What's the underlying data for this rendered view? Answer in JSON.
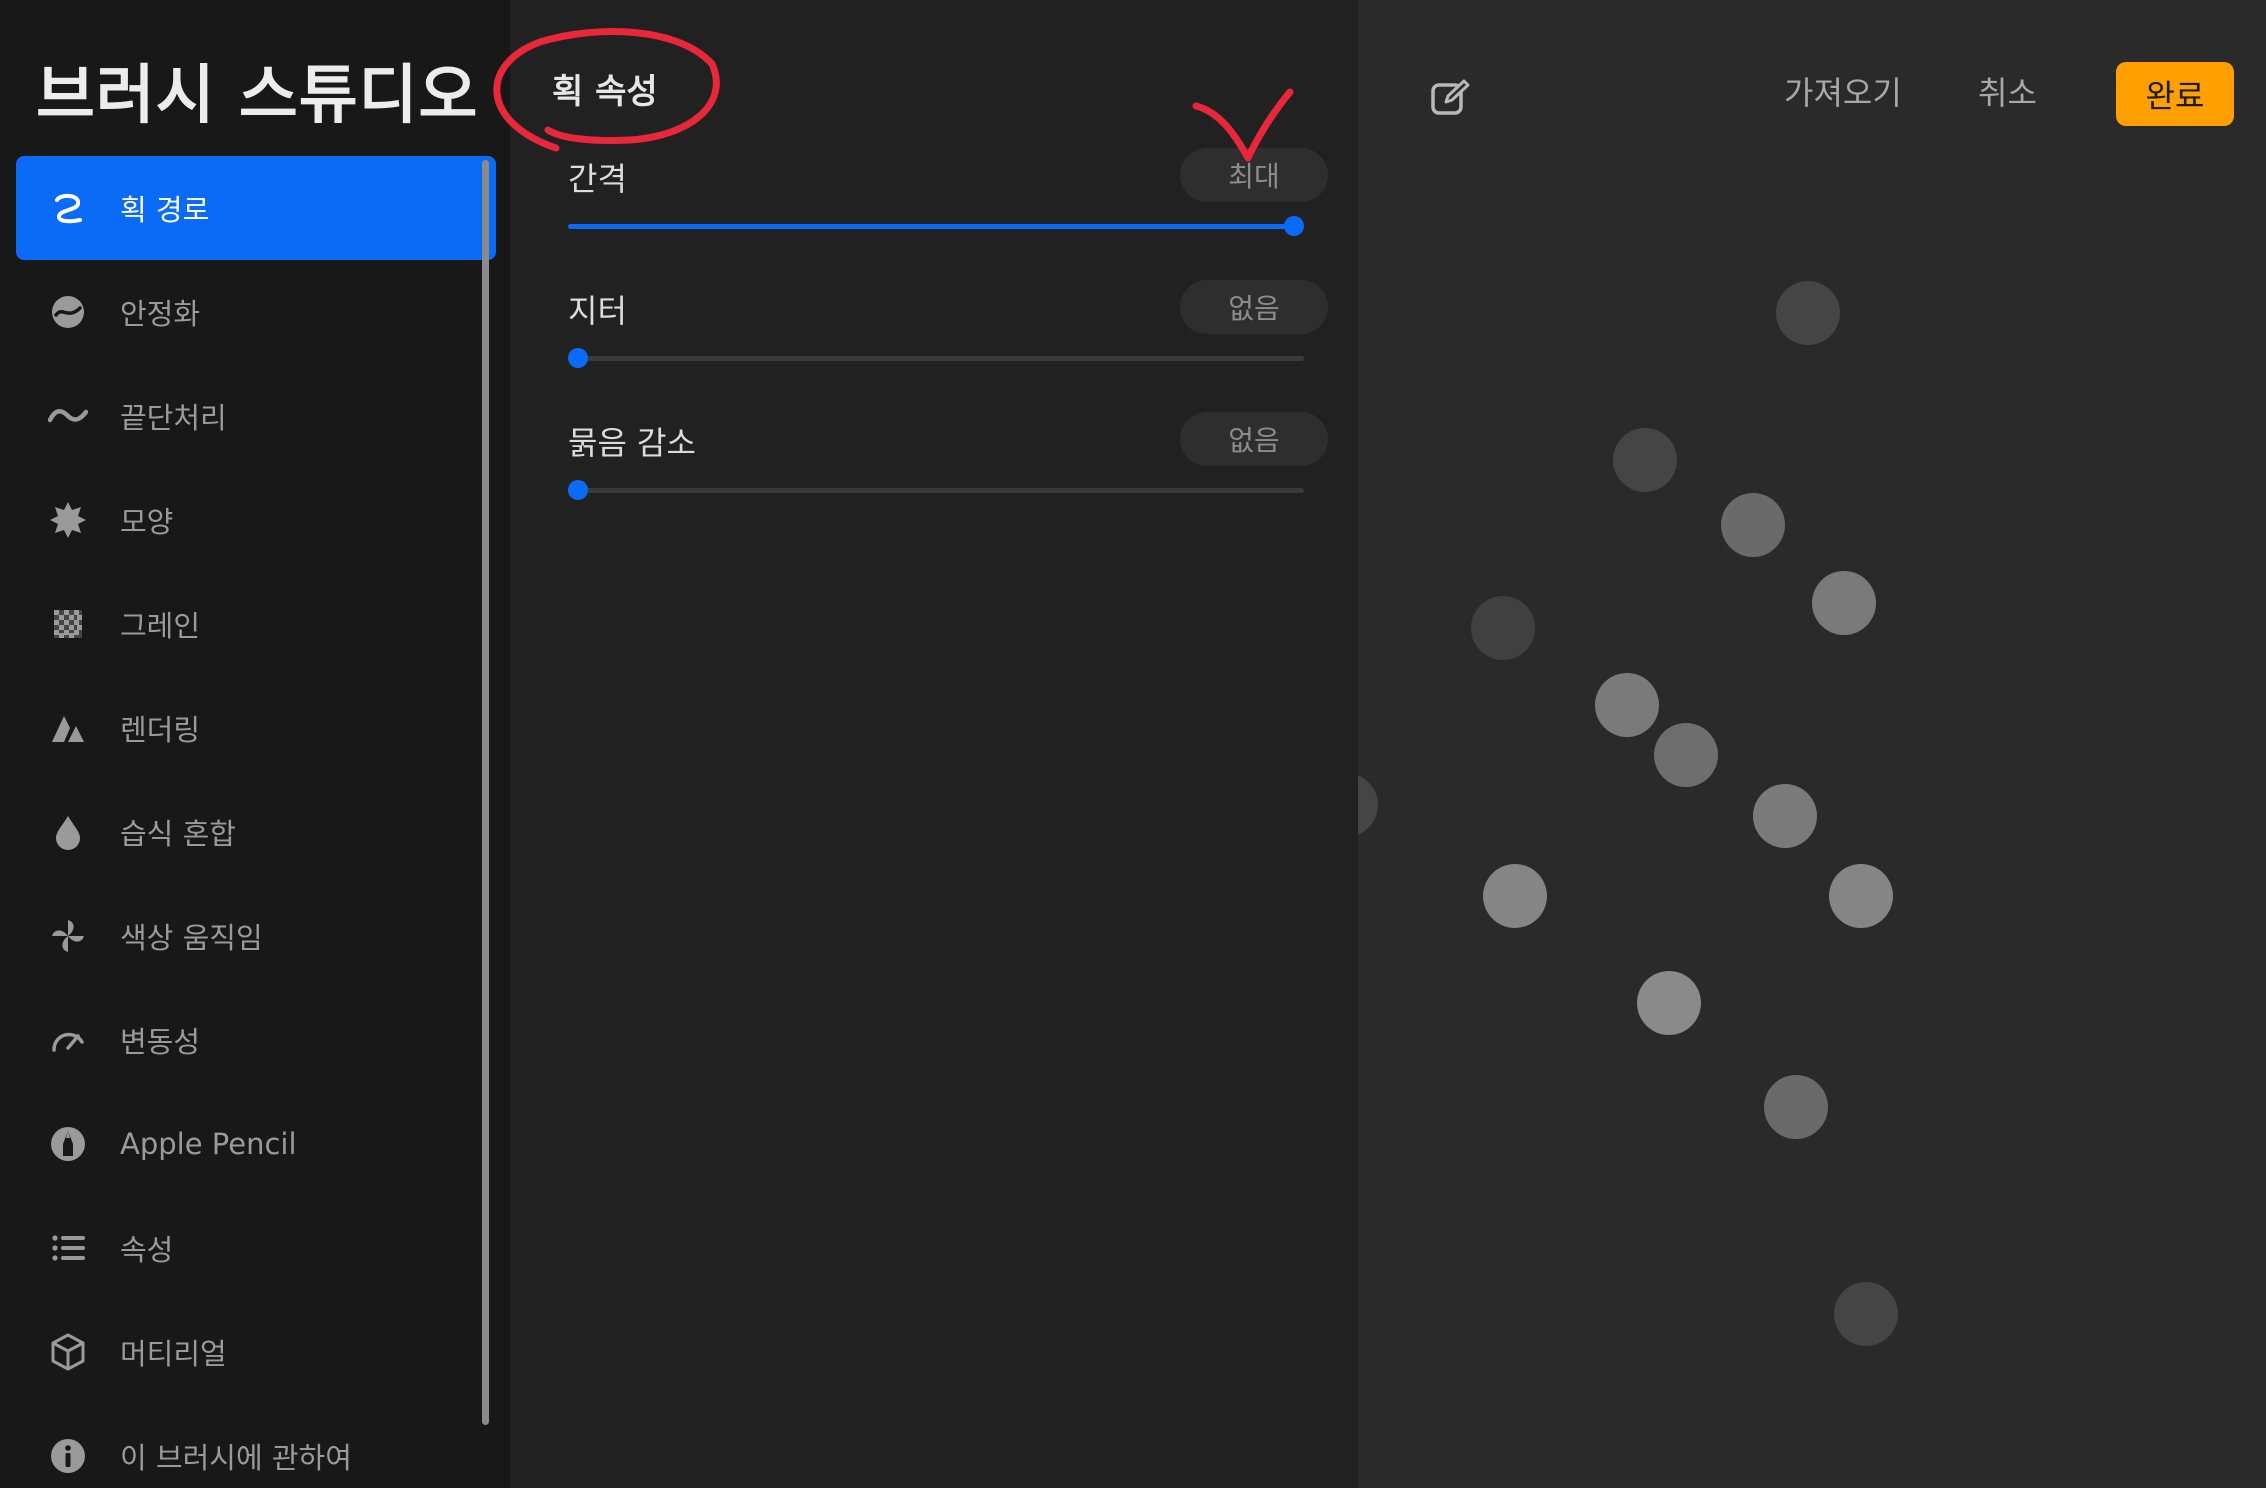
{
  "sidebar": {
    "title": "브러시 스튜디오",
    "items": [
      {
        "label": "획 경로",
        "icon": "stroke-path-icon",
        "selected": true
      },
      {
        "label": "안정화",
        "icon": "stabilization-icon"
      },
      {
        "label": "끝단처리",
        "icon": "taper-icon"
      },
      {
        "label": "모양",
        "icon": "shape-icon"
      },
      {
        "label": "그레인",
        "icon": "grain-icon"
      },
      {
        "label": "렌더링",
        "icon": "rendering-icon"
      },
      {
        "label": "습식 혼합",
        "icon": "wet-mix-icon"
      },
      {
        "label": "색상 움직임",
        "icon": "color-dynamics-icon"
      },
      {
        "label": "변동성",
        "icon": "dynamics-icon"
      },
      {
        "label": "Apple Pencil",
        "icon": "apple-pencil-icon"
      },
      {
        "label": "속성",
        "icon": "properties-icon"
      },
      {
        "label": "머티리얼",
        "icon": "materials-icon"
      },
      {
        "label": "이 브러시에 관하여",
        "icon": "info-icon"
      }
    ]
  },
  "panel": {
    "title": "획 속성",
    "settings": [
      {
        "label": "간격",
        "value": "최대",
        "level": 1.0
      },
      {
        "label": "지터",
        "value": "없음",
        "level": 0.0
      },
      {
        "label": "묽음 감소",
        "value": "없음",
        "level": 0.0
      }
    ]
  },
  "preview": {
    "import_label": "가져오기",
    "cancel_label": "취소",
    "done_label": "완료",
    "edit_icon": "edit-icon"
  },
  "colors": {
    "accent": "#0a6cf6",
    "done": "#ffa000",
    "annotation": "#e8273b"
  }
}
